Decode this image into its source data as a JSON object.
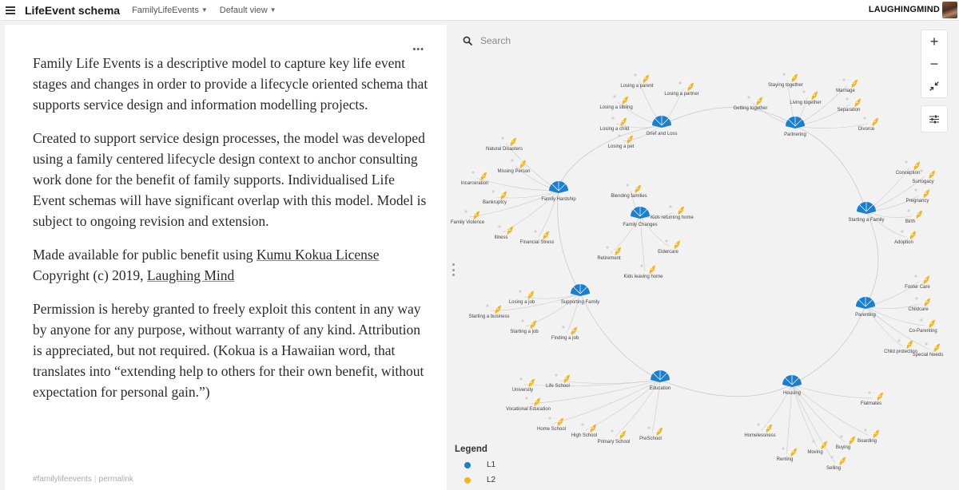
{
  "topbar": {
    "map_title": "LifeEvent schema",
    "project": "FamilyLifeEvents",
    "view": "Default view",
    "username": "LAUGHINGMIND"
  },
  "panel": {
    "paragraph1": "Family Life Events is a descriptive model to capture key life event stages and changes in order to provide a lifecycle oriented schema that supports service design and information modelling projects.",
    "paragraph2": "Created to support service design processes, the model was developed using a family centered lifecycle design context to anchor consulting work done for the benefit of family supports. Individualised Life Event schemas will have significant overlap with this model. Model is subject to ongoing revision and extension.",
    "p3_text1": "Made available for public benefit using ",
    "p3_link1": "Kumu Kokua License",
    "p3_text2": "Copyright (c) 2019, ",
    "p3_link2": "Laughing Mind",
    "paragraph4": "Permission is hereby granted to freely exploit this content in any way by anyone for any purpose, without warranty of any kind. Attribution is appreciated, but not required. (Kokua is a Hawaiian word, that translates into “extending help to others for their own benefit, without expectation for personal gain.”)",
    "tag_link": "#familylifeevents",
    "permalink": "permalink"
  },
  "map": {
    "search_placeholder": "Search",
    "zoom_in": "+",
    "zoom_out": "−",
    "colors": {
      "l1": "#1a7fcf",
      "l2": "#f5b61b",
      "edge": "#c9c9c9",
      "small_dot": "#d0d0d0"
    },
    "legend": {
      "title": "Legend",
      "items": [
        {
          "label": "L1",
          "color": "#1a7fcf"
        },
        {
          "label": "L2",
          "color": "#f5b61b"
        }
      ]
    },
    "hubs": [
      {
        "label": "Grief and Loss",
        "children": [
          "Losing a parent",
          "Losing a partner",
          "Losing a sibling",
          "Losing a child",
          "Losing a pet"
        ]
      },
      {
        "label": "Partnering",
        "children": [
          "Staying together",
          "Marriage",
          "Getting together",
          "Living together",
          "Separation",
          "Divorce"
        ]
      },
      {
        "label": "Family Hardship",
        "children": [
          "Natural Disasters",
          "Missing Person",
          "Incarceration",
          "Bankruptcy",
          "Family Violence",
          "Illness",
          "Financial Stress"
        ]
      },
      {
        "label": "Family Changes",
        "children": [
          "Blending families",
          "Kids returning home",
          "Retirement",
          "Eldercare",
          "Kids leaving home"
        ]
      },
      {
        "label": "Starting a Family",
        "children": [
          "Conception",
          "Surrogacy",
          "Pregnancy",
          "Birth",
          "Adoption"
        ]
      },
      {
        "label": "Supporting Family",
        "children": [
          "Losing a job",
          "Starting a business",
          "Starting a job",
          "Finding a job"
        ]
      },
      {
        "label": "Parenting",
        "children": [
          "Foster Care",
          "Childcare",
          "Co-Parenting",
          "Child protection",
          "Special Needs"
        ]
      },
      {
        "label": "Education",
        "children": [
          "University",
          "Life School",
          "Vocational Education",
          "Home School",
          "High School",
          "Primary School",
          "PreSchool"
        ]
      },
      {
        "label": "Housing",
        "children": [
          "Homelessness",
          "Renting",
          "Moving",
          "Buying",
          "Selling",
          "Boarding",
          "Flatmates"
        ]
      }
    ]
  }
}
